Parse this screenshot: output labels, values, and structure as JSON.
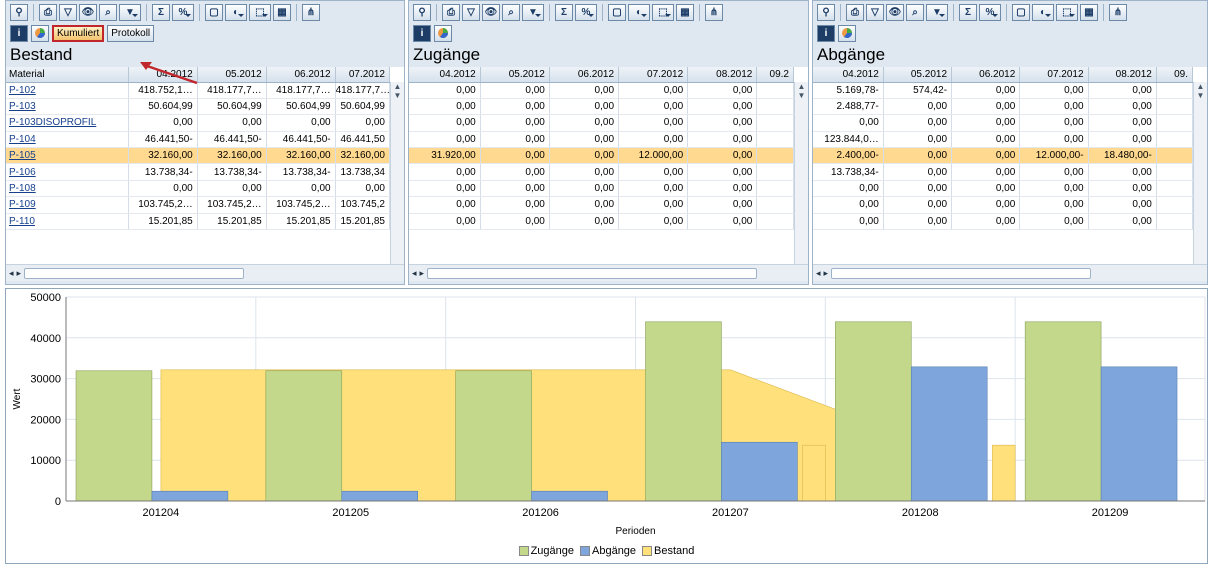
{
  "toolbar_glyphs": [
    "⚲",
    "⎙",
    "▽",
    "👁",
    "⌕",
    "▼",
    "Σ",
    "%",
    "▢",
    "◐",
    "⬚",
    "▦",
    "⋔"
  ],
  "panes": [
    {
      "title": "Bestand",
      "has_material": true,
      "buttons": [
        {
          "label": "Kumuliert",
          "active": true
        },
        {
          "label": "Protokoll",
          "active": false
        }
      ],
      "columns": [
        "Material",
        "04.2012",
        "05.2012",
        "06.2012",
        "07.2012"
      ],
      "rows": [
        [
          "P-102",
          "418.752,1…",
          "418.177,7…",
          "418.177,7…",
          "418.177,7…"
        ],
        [
          "P-103",
          "50.604,99",
          "50.604,99",
          "50.604,99",
          "50.604,99"
        ],
        [
          "P-103DISOPROFIL",
          "0,00",
          "0,00",
          "0,00",
          "0,00"
        ],
        [
          "P-104",
          "46.441,50-",
          "46.441,50-",
          "46.441,50-",
          "46.441,50"
        ],
        [
          "P-105",
          "32.160,00",
          "32.160,00",
          "32.160,00",
          "32.160,00"
        ],
        [
          "P-106",
          "13.738,34-",
          "13.738,34-",
          "13.738,34-",
          "13.738,34"
        ],
        [
          "P-108",
          "0,00",
          "0,00",
          "0,00",
          "0,00"
        ],
        [
          "P-109",
          "103.745,2…",
          "103.745,2…",
          "103.745,2…",
          "103.745,2"
        ],
        [
          "P-110",
          "15.201,85",
          "15.201,85",
          "15.201,85",
          "15.201,85"
        ]
      ]
    },
    {
      "title": "Zugänge",
      "has_material": false,
      "buttons": [],
      "columns": [
        "04.2012",
        "05.2012",
        "06.2012",
        "07.2012",
        "08.2012",
        "09.2"
      ],
      "rows": [
        [
          "0,00",
          "0,00",
          "0,00",
          "0,00",
          "0,00",
          ""
        ],
        [
          "0,00",
          "0,00",
          "0,00",
          "0,00",
          "0,00",
          ""
        ],
        [
          "0,00",
          "0,00",
          "0,00",
          "0,00",
          "0,00",
          ""
        ],
        [
          "0,00",
          "0,00",
          "0,00",
          "0,00",
          "0,00",
          ""
        ],
        [
          "31.920,00",
          "0,00",
          "0,00",
          "12.000,00",
          "0,00",
          ""
        ],
        [
          "0,00",
          "0,00",
          "0,00",
          "0,00",
          "0,00",
          ""
        ],
        [
          "0,00",
          "0,00",
          "0,00",
          "0,00",
          "0,00",
          ""
        ],
        [
          "0,00",
          "0,00",
          "0,00",
          "0,00",
          "0,00",
          ""
        ],
        [
          "0,00",
          "0,00",
          "0,00",
          "0,00",
          "0,00",
          ""
        ]
      ]
    },
    {
      "title": "Abgänge",
      "has_material": false,
      "buttons": [],
      "columns": [
        "04.2012",
        "05.2012",
        "06.2012",
        "07.2012",
        "08.2012",
        "09."
      ],
      "rows": [
        [
          "5.169,78-",
          "574,42-",
          "0,00",
          "0,00",
          "0,00",
          ""
        ],
        [
          "2.488,77-",
          "0,00",
          "0,00",
          "0,00",
          "0,00",
          ""
        ],
        [
          "0,00",
          "0,00",
          "0,00",
          "0,00",
          "0,00",
          ""
        ],
        [
          "123.844,0…",
          "0,00",
          "0,00",
          "0,00",
          "0,00",
          ""
        ],
        [
          "2.400,00-",
          "0,00",
          "0,00",
          "12.000,00-",
          "18.480,00-",
          ""
        ],
        [
          "13.738,34-",
          "0,00",
          "0,00",
          "0,00",
          "0,00",
          ""
        ],
        [
          "0,00",
          "0,00",
          "0,00",
          "0,00",
          "0,00",
          ""
        ],
        [
          "0,00",
          "0,00",
          "0,00",
          "0,00",
          "0,00",
          ""
        ],
        [
          "0,00",
          "0,00",
          "0,00",
          "0,00",
          "0,00",
          ""
        ]
      ]
    }
  ],
  "selected_row": 4,
  "chart_data": {
    "type": "bar",
    "categories": [
      "201204",
      "201205",
      "201206",
      "201207",
      "201208",
      "201209"
    ],
    "series": [
      {
        "name": "Zugänge",
        "color": "#c3d88a",
        "values": [
          31920,
          31920,
          31920,
          43920,
          43920,
          43920
        ]
      },
      {
        "name": "Abgänge",
        "color": "#7ea6dc",
        "values": [
          2400,
          2400,
          2400,
          14400,
          32880,
          32880
        ]
      },
      {
        "name": "Bestand",
        "color": "#ffe07a",
        "type": "area",
        "values": [
          32160,
          32160,
          32160,
          32160,
          13680,
          13680
        ]
      }
    ],
    "xlabel": "Perioden",
    "ylabel": "Wert",
    "ylim": [
      0,
      50000
    ],
    "yticks": [
      0,
      10000,
      20000,
      30000,
      40000,
      50000
    ]
  }
}
